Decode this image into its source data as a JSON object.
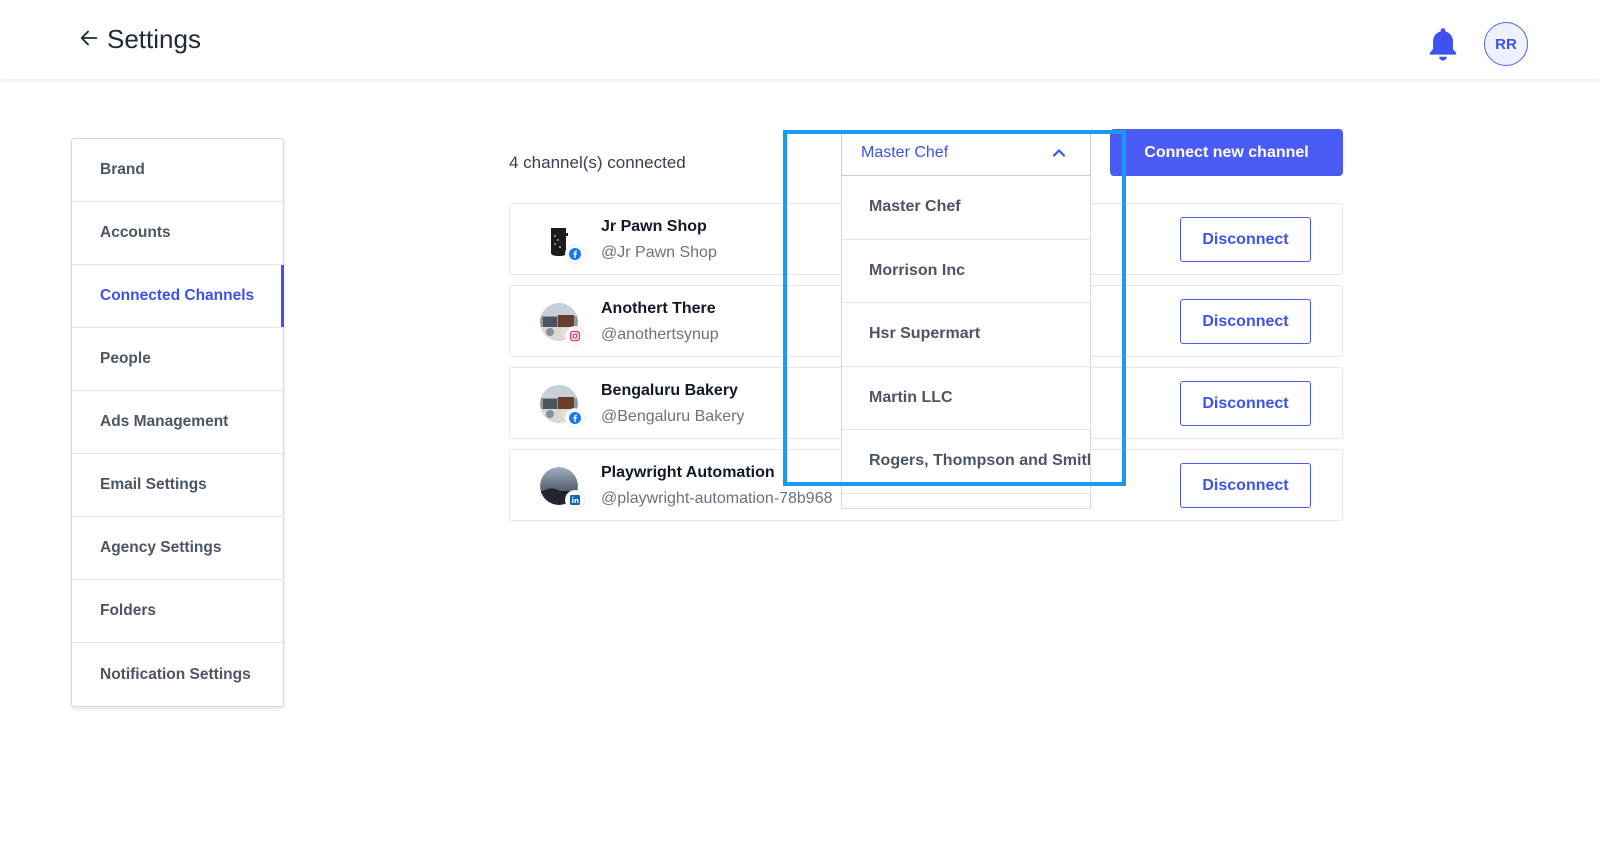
{
  "header": {
    "back_icon": "arrow-left-icon",
    "title": "Settings",
    "notification_icon": "bell-icon",
    "avatar_initials": "RR"
  },
  "sidebar": {
    "items": [
      {
        "label": "Brand",
        "active": false
      },
      {
        "label": "Accounts",
        "active": false
      },
      {
        "label": "Connected Channels",
        "active": true
      },
      {
        "label": "People",
        "active": false
      },
      {
        "label": "Ads Management",
        "active": false
      },
      {
        "label": "Email Settings",
        "active": false
      },
      {
        "label": "Agency Settings",
        "active": false
      },
      {
        "label": "Folders",
        "active": false
      },
      {
        "label": "Notification Settings",
        "active": false
      }
    ]
  },
  "main": {
    "channel_count": "4 channel(s) connected",
    "brand_select": {
      "selected": "Master Chef",
      "expanded": true,
      "options": [
        "Master Chef",
        "Morrison Inc",
        "Hsr Supermart",
        "Martin LLC",
        "Rogers, Thompson and Smith"
      ]
    },
    "connect_button": "Connect new channel",
    "channels": [
      {
        "name": "Jr Pawn Shop",
        "handle": "@Jr Pawn Shop",
        "platform": "facebook-icon",
        "action": "Disconnect"
      },
      {
        "name": "Anothert There",
        "handle": "@anothertsynup",
        "platform": "instagram-icon",
        "action": "Disconnect"
      },
      {
        "name": "Bengaluru Bakery",
        "handle": "@Bengaluru Bakery",
        "platform": "facebook-icon",
        "action": "Disconnect"
      },
      {
        "name": "Playwright Automation",
        "handle": "@playwright-automation-78b968",
        "platform": "linkedin-icon",
        "action": "Disconnect"
      }
    ]
  },
  "colors": {
    "accent": "#4b5cf6",
    "highlight": "#1a9bf0",
    "facebook": "#1877f2",
    "instagram": "#e1306c",
    "linkedin": "#0a66c2"
  }
}
